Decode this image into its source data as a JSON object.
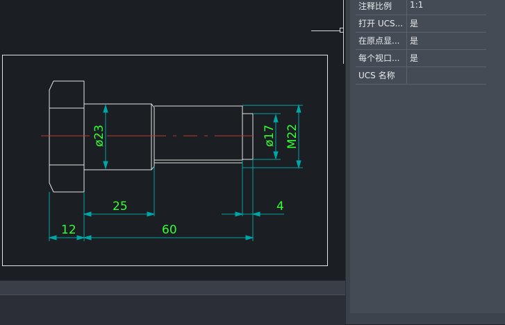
{
  "properties": [
    {
      "name": "注释比例",
      "value": "1:1"
    },
    {
      "name": "打开 UCS...",
      "value": "是"
    },
    {
      "name": "在原点显...",
      "value": "是"
    },
    {
      "name": "每个视口...",
      "value": "是"
    },
    {
      "name": "UCS 名称",
      "value": ""
    }
  ],
  "dimensions": {
    "dia_shank": "ø23",
    "dia_neck": "ø17",
    "thread": "M22",
    "len_25": "25",
    "len_4": "4",
    "len_12": "12",
    "len_60": "60"
  },
  "colors": {
    "outline": "#e6e6e6",
    "dimension": "#00a6a6",
    "dim_text": "#33ff33",
    "centerline": "#c0392b"
  }
}
